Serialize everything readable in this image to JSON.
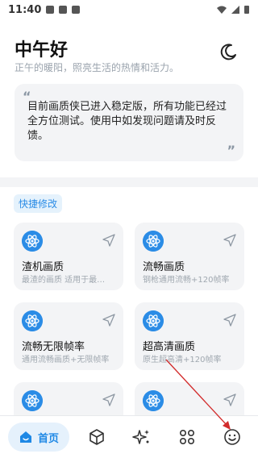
{
  "status_bar": {
    "time": "11:40"
  },
  "greeting": {
    "title": "中午好",
    "subtitle": "正午的暖阳，照亮生活的热情和活力。"
  },
  "quote": {
    "open_mark": "“",
    "text": "目前画质侠已进入稳定版，所有功能已经过全方位测试。使用中如发现问题请及时反馈。",
    "close_mark": "”"
  },
  "quick_edit": {
    "label": "快捷修改",
    "cards": [
      {
        "title": "渣机画质",
        "desc": "最渣的画质 适用于最…",
        "icon": "atom-icon"
      },
      {
        "title": "流畅画质",
        "desc": "钢枪通用流畅+120帧率",
        "icon": "atom-icon"
      },
      {
        "title": "流畅无限帧率",
        "desc": "通用流畅画质+无限帧率",
        "icon": "atom-icon"
      },
      {
        "title": "超高清画质",
        "desc": "原生超高清+120帧率",
        "icon": "atom-icon"
      },
      {
        "title": "",
        "desc": "",
        "icon": "atom-icon"
      },
      {
        "title": "",
        "desc": "",
        "icon": "atom-icon"
      }
    ]
  },
  "bottom_nav": {
    "home_label": "首页",
    "items": [
      "home-icon",
      "cube-icon",
      "sparkles-icon",
      "apps-grid-icon",
      "smile-icon"
    ]
  },
  "colors": {
    "accent": "#2b8ce6",
    "chip_bg": "#e5f2fc",
    "annotation_arrow": "#d22b2b"
  }
}
